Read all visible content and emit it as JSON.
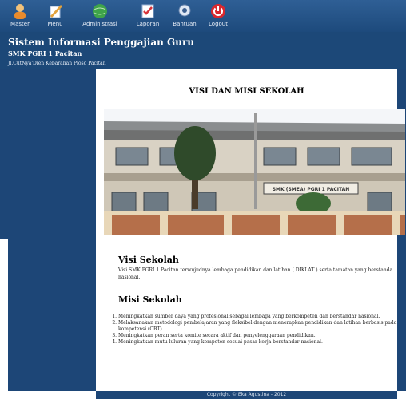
{
  "menu": {
    "items": [
      {
        "label": "Master",
        "icon": "user-icon"
      },
      {
        "label": "Menu",
        "icon": "pencil-icon"
      },
      {
        "label": "Administrasi",
        "icon": "globe-icon"
      },
      {
        "label": "Laporan",
        "icon": "report-icon"
      },
      {
        "label": "Bantuan",
        "icon": "help-icon"
      },
      {
        "label": "Logout",
        "icon": "power-icon"
      }
    ]
  },
  "header": {
    "title": "Sistem Informasi Penggajian Guru",
    "school": "SMK PGRI 1 Pacitan",
    "address": "Jl.CutNya'Dien Kebarahan Ploso Pacitan"
  },
  "content": {
    "title": "VISI DAN MISI SEKOLAH",
    "photo_sign": "SMK (SMEA) PGRI 1 PACITAN",
    "visi_heading": "Visi Sekolah",
    "visi_text": "Visi SMK PGRI 1 Pacitan terwujudnya lembaga pendidikan dan latihan ( DIKLAT ) serta tamatan yang berstanda nasional.",
    "misi_heading": "Misi Sekolah",
    "misi_items": [
      "Meningkatkan sumber daya yang profesional sebagai lembaga yang berkompeten dan berstandar nasional.",
      "Melaksanakan metodologi pembelajaran yang fleksibel dengan menerapkan pendidikan dan latihan berbasis pada kompetensi (CBT).",
      "Meningkatkan peran serta komite secara aktif dan penyelenggaraan pendidikan.",
      "Meningkatkan mutu luluran yang kompeten sesuai pasar kerja berstandar nasional."
    ]
  },
  "footer": {
    "text": "Copyright © Eka Agustina - 2012"
  },
  "colors": {
    "topbar": "#2f5f95",
    "header": "#1c4878",
    "sidebar": "#1d4677"
  }
}
